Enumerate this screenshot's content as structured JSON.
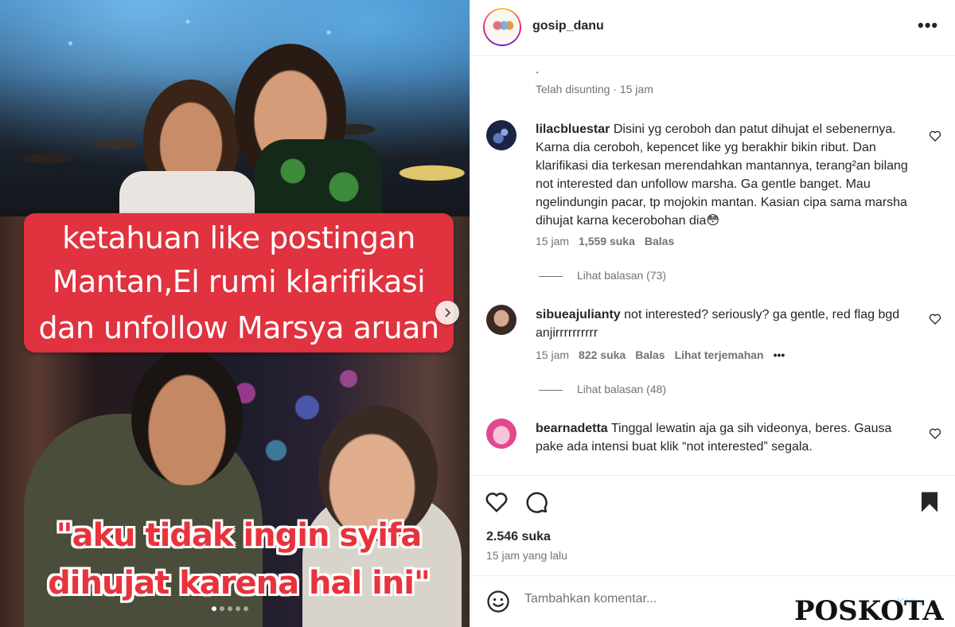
{
  "post": {
    "image_text": {
      "banner_line1": "ketahuan like postingan",
      "banner_line2": "Mantan,El rumi klarifikasi",
      "banner_line3": "dan unfollow Marsya aruan",
      "quote_line1": "\"aku tidak ingin syifa",
      "quote_line2": "dihujat karena hal ini\""
    },
    "carousel": {
      "slide_count": 5,
      "active_index": 0
    }
  },
  "header": {
    "username": "gosip_danu",
    "more_label": "•••"
  },
  "previous": {
    "text": ".",
    "meta": "Telah disunting · 15 jam"
  },
  "comments": [
    {
      "username": "lilacbluestar",
      "text": "Disini yg ceroboh dan patut dihujat el sebenernya. Karna dia ceroboh, kepencet like yg berakhir bikin ribut. Dan klarifikasi dia terkesan merendahkan mantannya, terang²an bilang not interested dan unfollow marsha. Ga gentle banget. Mau ngelindungin pacar, tp mojokin mantan. Kasian cipa sama marsha dihujat karna kecerobohan dia😳",
      "time": "15 jam",
      "likes": "1,559 suka",
      "reply_label": "Balas",
      "replies": "Lihat balasan (73)"
    },
    {
      "username": "sibueajulianty",
      "text": "not interested? seriously? ga gentle, red flag bgd anjirrrrrrrrrr",
      "time": "15 jam",
      "likes": "822 suka",
      "reply_label": "Balas",
      "translate_label": "Lihat terjemahan",
      "more": "•••",
      "replies": "Lihat balasan (48)"
    },
    {
      "username": "bearnadetta",
      "text": "Tinggal lewatin aja ga sih videonya, beres. Gausa pake ada intensi buat klik “not interested” segala."
    }
  ],
  "footer": {
    "likes": "2.546 suka",
    "time": "15 jam yang lalu",
    "comment_placeholder": "Tambahkan komentar...",
    "send_label": "Kirim"
  },
  "watermark": "POSKOTA",
  "colors": {
    "banner_red": "#e0323f",
    "send_blue": "#b2dffc",
    "muted_text": "#737373"
  }
}
